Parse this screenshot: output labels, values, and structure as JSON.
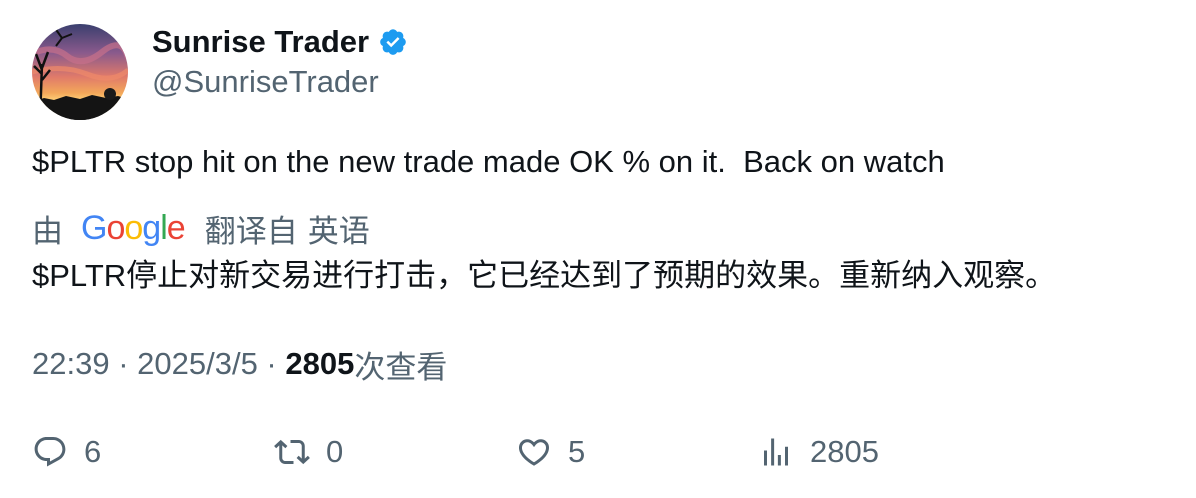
{
  "author": {
    "display_name": "Sunrise Trader",
    "handle": "@SunriseTrader",
    "verified": true,
    "verified_color": "#1d9bf0",
    "avatar_icon": "sunset-photo-avatar"
  },
  "tweet": {
    "text": "$PLTR stop hit on the new trade made OK % on it.  Back on watch"
  },
  "translation": {
    "by_label": "由",
    "provider_letters": [
      "G",
      "o",
      "o",
      "g",
      "l",
      "e"
    ],
    "from_label": "翻译自",
    "language": "英语",
    "translated_text": "$PLTR停止对新交易进行打击，它已经达到了预期的效果。重新纳入观察。"
  },
  "meta": {
    "time": "22:39",
    "separator": " · ",
    "date": "2025/3/5",
    "views_count": "2805",
    "views_label": "次查看"
  },
  "actions": {
    "reply": {
      "icon": "reply-bubble-icon",
      "count": "6"
    },
    "retweet": {
      "icon": "retweet-icon",
      "count": "0"
    },
    "like": {
      "icon": "heart-icon",
      "count": "5"
    },
    "views": {
      "icon": "bar-chart-icon",
      "count": "2805"
    }
  },
  "colors": {
    "text_primary": "#0f1419",
    "text_secondary": "#536471",
    "accent": "#1d9bf0"
  }
}
